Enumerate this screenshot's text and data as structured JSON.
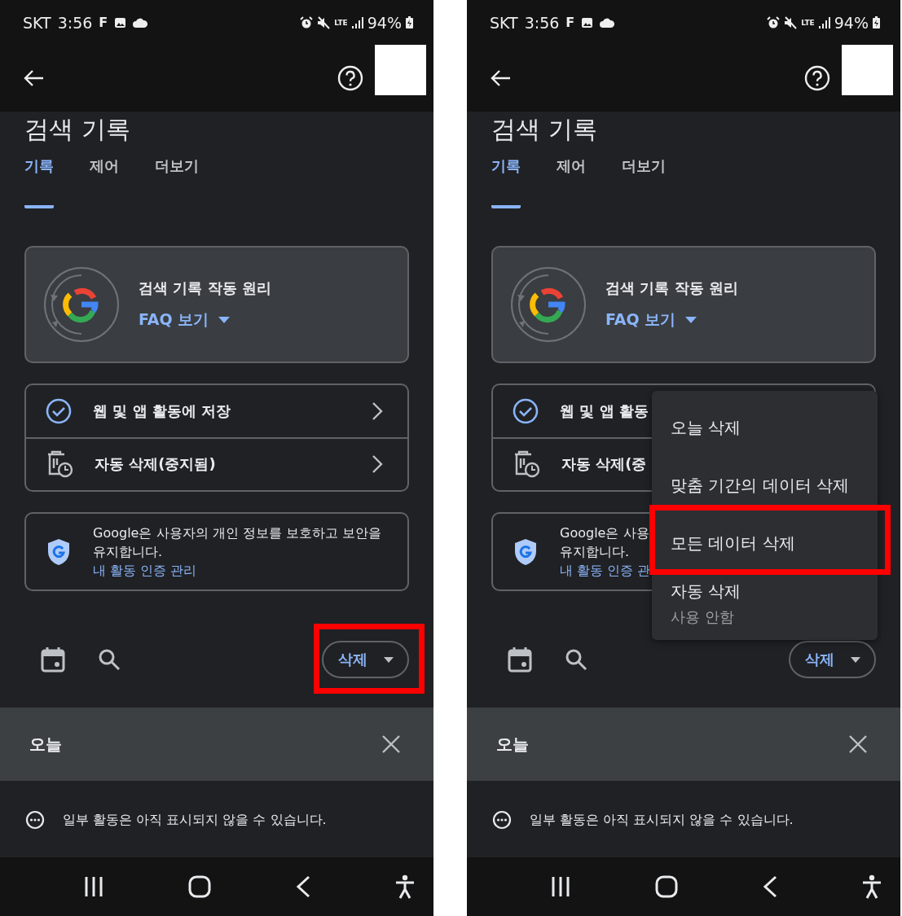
{
  "screens": [
    {
      "status_bar": {
        "carrier": "SKT",
        "time": "3:56",
        "notification_letter": "F",
        "network": "LTE",
        "battery": "94%"
      },
      "title": "검색 기록",
      "tabs": [
        {
          "label": "기록",
          "selected": true
        },
        {
          "label": "제어",
          "selected": false
        },
        {
          "label": "더보기",
          "selected": false
        }
      ],
      "info_card": {
        "title": "검색 기록 작동 원리",
        "link": "FAQ 보기"
      },
      "settings": [
        {
          "kind": "check",
          "label": "웹 및 앱 활동에 저장",
          "chevron": true
        },
        {
          "kind": "auto_delete",
          "label": "자동 삭제(중지됨)",
          "chevron": true
        }
      ],
      "notice": {
        "lines": [
          "Google은 사용자의 개인 정보를 보호하고 보안을",
          "유지합니다."
        ],
        "link": "내 활동 인증 관리"
      },
      "delete_button": {
        "label": "삭제",
        "highlighted": true
      },
      "day": {
        "label": "오늘"
      },
      "info_line": "일부 활동은 아직 표시되지 않을 수 있습니다."
    },
    {
      "status_bar": {
        "carrier": "SKT",
        "time": "3:56",
        "notification_letter": "F",
        "network": "LTE",
        "battery": "94%"
      },
      "title": "검색 기록",
      "tabs": [
        {
          "label": "기록",
          "selected": true
        },
        {
          "label": "제어",
          "selected": false
        },
        {
          "label": "더보기",
          "selected": false
        }
      ],
      "info_card": {
        "title": "검색 기록 작동 원리",
        "link": "FAQ 보기"
      },
      "settings": [
        {
          "kind": "check",
          "label": "웹 및 앱 활동",
          "chevron": false
        },
        {
          "kind": "auto_delete",
          "label": "자동 삭제(중",
          "chevron": false
        }
      ],
      "notice": {
        "lines": [
          "Google은 사용",
          "유지합니다."
        ],
        "link": "내 활동 인증 관"
      },
      "delete_button": {
        "label": "삭제",
        "highlighted": false
      },
      "menu": {
        "items": [
          {
            "label": "오늘 삭제",
            "highlighted": false
          },
          {
            "label": "맞춤 기간의 데이터 삭제",
            "highlighted": false
          },
          {
            "label": "모든 데이터 삭제",
            "highlighted": true
          },
          {
            "label": "자동 삭제",
            "sublabel": "사용 안함",
            "highlighted": false
          }
        ]
      },
      "day": {
        "label": "오늘"
      },
      "info_line": "일부 활동은 아직 표시되지 않을 수 있습니다."
    }
  ]
}
